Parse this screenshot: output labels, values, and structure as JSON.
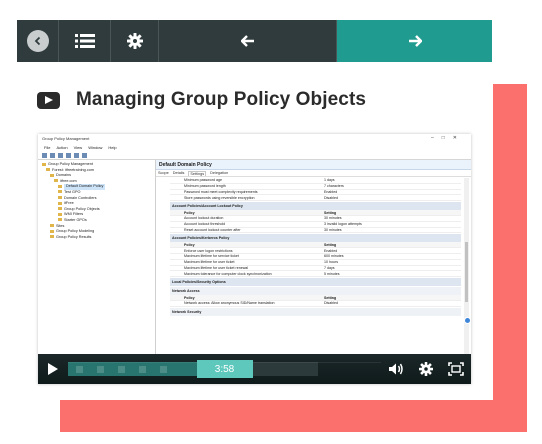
{
  "nav": {
    "back_icon": "chevron-left-circle-icon",
    "list_icon": "list-icon",
    "settings_icon": "gear-icon",
    "prev_icon": "arrow-left-icon",
    "next_icon": "arrow-right-icon",
    "colors": {
      "dark": "#2f3b3c",
      "accent": "#1f9c8f"
    }
  },
  "lesson": {
    "icon": "video-play-icon",
    "title": "Managing Group Policy Objects"
  },
  "video": {
    "window_title": "Group Policy Management",
    "menu": [
      "File",
      "Action",
      "View",
      "Window",
      "Help"
    ],
    "tree": [
      "Group Policy Management",
      "Forest: itfreetraining.com",
      "Domains",
      "itfree.com",
      "Default Domain Policy",
      "Test GPO",
      "Domain Controllers",
      "itFree",
      "Group Policy Objects",
      "WMI Filters",
      "Starter GPOs",
      "Sites",
      "Group Policy Modeling",
      "Group Policy Results"
    ],
    "detail_title": "Default Domain Policy",
    "tabs": [
      "Scope",
      "Details",
      "Settings",
      "Delegation"
    ],
    "active_tab": "Settings",
    "top_rows": [
      {
        "k": "Minimum password age",
        "v": "1 days"
      },
      {
        "k": "Minimum password length",
        "v": "7 characters"
      },
      {
        "k": "Password must meet complexity requirements",
        "v": "Enabled"
      },
      {
        "k": "Store passwords using reversible encryption",
        "v": "Disabled"
      }
    ],
    "lockout_section": "Account Policies/Account Lockout Policy",
    "lockout_header": {
      "k": "Policy",
      "v": "Setting"
    },
    "lockout_rows": [
      {
        "k": "Account lockout duration",
        "v": "30 minutes"
      },
      {
        "k": "Account lockout threshold",
        "v": "3 invalid logon attempts"
      },
      {
        "k": "Reset account lockout counter after",
        "v": "30 minutes"
      }
    ],
    "kerberos_section": "Account Policies/Kerberos Policy",
    "kerberos_header": {
      "k": "Policy",
      "v": "Setting"
    },
    "kerberos_rows": [
      {
        "k": "Enforce user logon restrictions",
        "v": "Enabled"
      },
      {
        "k": "Maximum lifetime for service ticket",
        "v": "600 minutes"
      },
      {
        "k": "Maximum lifetime for user ticket",
        "v": "10 hours"
      },
      {
        "k": "Maximum lifetime for user ticket renewal",
        "v": "7 days"
      },
      {
        "k": "Maximum tolerance for computer clock synchronization",
        "v": "5 minutes"
      }
    ],
    "local_section": "Local Policies/Security Options",
    "network_access": "Network Access",
    "network_header": {
      "k": "Policy",
      "v": "Setting"
    },
    "network_rows": [
      {
        "k": "Network access: Allow anonymous SID/Name translation",
        "v": "Disabled"
      }
    ],
    "network_security": "Network Security"
  },
  "player": {
    "time": "3:58",
    "played_fraction": 0.5,
    "play_icon": "play-icon",
    "volume_icon": "volume-icon",
    "settings_icon": "gear-icon",
    "fullscreen_icon": "fullscreen-icon",
    "accent": "#5fc8bd"
  },
  "decor": {
    "color": "#fb6f6c"
  }
}
